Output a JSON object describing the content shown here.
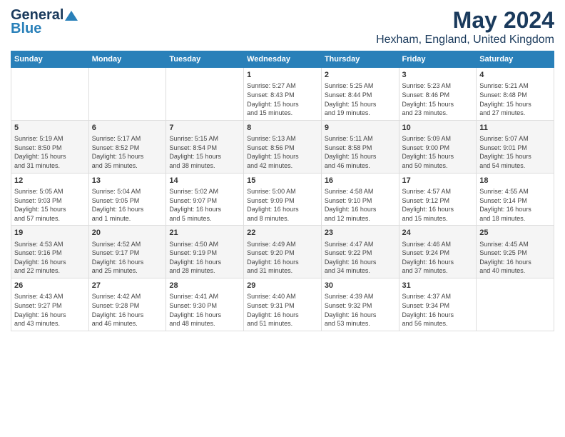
{
  "logo": {
    "line1": "General",
    "line2": "Blue"
  },
  "title": "May 2024",
  "subtitle": "Hexham, England, United Kingdom",
  "days_of_week": [
    "Sunday",
    "Monday",
    "Tuesday",
    "Wednesday",
    "Thursday",
    "Friday",
    "Saturday"
  ],
  "weeks": [
    [
      {
        "day": "",
        "content": ""
      },
      {
        "day": "",
        "content": ""
      },
      {
        "day": "",
        "content": ""
      },
      {
        "day": "1",
        "content": "Sunrise: 5:27 AM\nSunset: 8:43 PM\nDaylight: 15 hours\nand 15 minutes."
      },
      {
        "day": "2",
        "content": "Sunrise: 5:25 AM\nSunset: 8:44 PM\nDaylight: 15 hours\nand 19 minutes."
      },
      {
        "day": "3",
        "content": "Sunrise: 5:23 AM\nSunset: 8:46 PM\nDaylight: 15 hours\nand 23 minutes."
      },
      {
        "day": "4",
        "content": "Sunrise: 5:21 AM\nSunset: 8:48 PM\nDaylight: 15 hours\nand 27 minutes."
      }
    ],
    [
      {
        "day": "5",
        "content": "Sunrise: 5:19 AM\nSunset: 8:50 PM\nDaylight: 15 hours\nand 31 minutes."
      },
      {
        "day": "6",
        "content": "Sunrise: 5:17 AM\nSunset: 8:52 PM\nDaylight: 15 hours\nand 35 minutes."
      },
      {
        "day": "7",
        "content": "Sunrise: 5:15 AM\nSunset: 8:54 PM\nDaylight: 15 hours\nand 38 minutes."
      },
      {
        "day": "8",
        "content": "Sunrise: 5:13 AM\nSunset: 8:56 PM\nDaylight: 15 hours\nand 42 minutes."
      },
      {
        "day": "9",
        "content": "Sunrise: 5:11 AM\nSunset: 8:58 PM\nDaylight: 15 hours\nand 46 minutes."
      },
      {
        "day": "10",
        "content": "Sunrise: 5:09 AM\nSunset: 9:00 PM\nDaylight: 15 hours\nand 50 minutes."
      },
      {
        "day": "11",
        "content": "Sunrise: 5:07 AM\nSunset: 9:01 PM\nDaylight: 15 hours\nand 54 minutes."
      }
    ],
    [
      {
        "day": "12",
        "content": "Sunrise: 5:05 AM\nSunset: 9:03 PM\nDaylight: 15 hours\nand 57 minutes."
      },
      {
        "day": "13",
        "content": "Sunrise: 5:04 AM\nSunset: 9:05 PM\nDaylight: 16 hours\nand 1 minute."
      },
      {
        "day": "14",
        "content": "Sunrise: 5:02 AM\nSunset: 9:07 PM\nDaylight: 16 hours\nand 5 minutes."
      },
      {
        "day": "15",
        "content": "Sunrise: 5:00 AM\nSunset: 9:09 PM\nDaylight: 16 hours\nand 8 minutes."
      },
      {
        "day": "16",
        "content": "Sunrise: 4:58 AM\nSunset: 9:10 PM\nDaylight: 16 hours\nand 12 minutes."
      },
      {
        "day": "17",
        "content": "Sunrise: 4:57 AM\nSunset: 9:12 PM\nDaylight: 16 hours\nand 15 minutes."
      },
      {
        "day": "18",
        "content": "Sunrise: 4:55 AM\nSunset: 9:14 PM\nDaylight: 16 hours\nand 18 minutes."
      }
    ],
    [
      {
        "day": "19",
        "content": "Sunrise: 4:53 AM\nSunset: 9:16 PM\nDaylight: 16 hours\nand 22 minutes."
      },
      {
        "day": "20",
        "content": "Sunrise: 4:52 AM\nSunset: 9:17 PM\nDaylight: 16 hours\nand 25 minutes."
      },
      {
        "day": "21",
        "content": "Sunrise: 4:50 AM\nSunset: 9:19 PM\nDaylight: 16 hours\nand 28 minutes."
      },
      {
        "day": "22",
        "content": "Sunrise: 4:49 AM\nSunset: 9:20 PM\nDaylight: 16 hours\nand 31 minutes."
      },
      {
        "day": "23",
        "content": "Sunrise: 4:47 AM\nSunset: 9:22 PM\nDaylight: 16 hours\nand 34 minutes."
      },
      {
        "day": "24",
        "content": "Sunrise: 4:46 AM\nSunset: 9:24 PM\nDaylight: 16 hours\nand 37 minutes."
      },
      {
        "day": "25",
        "content": "Sunrise: 4:45 AM\nSunset: 9:25 PM\nDaylight: 16 hours\nand 40 minutes."
      }
    ],
    [
      {
        "day": "26",
        "content": "Sunrise: 4:43 AM\nSunset: 9:27 PM\nDaylight: 16 hours\nand 43 minutes."
      },
      {
        "day": "27",
        "content": "Sunrise: 4:42 AM\nSunset: 9:28 PM\nDaylight: 16 hours\nand 46 minutes."
      },
      {
        "day": "28",
        "content": "Sunrise: 4:41 AM\nSunset: 9:30 PM\nDaylight: 16 hours\nand 48 minutes."
      },
      {
        "day": "29",
        "content": "Sunrise: 4:40 AM\nSunset: 9:31 PM\nDaylight: 16 hours\nand 51 minutes."
      },
      {
        "day": "30",
        "content": "Sunrise: 4:39 AM\nSunset: 9:32 PM\nDaylight: 16 hours\nand 53 minutes."
      },
      {
        "day": "31",
        "content": "Sunrise: 4:37 AM\nSunset: 9:34 PM\nDaylight: 16 hours\nand 56 minutes."
      },
      {
        "day": "",
        "content": ""
      }
    ]
  ]
}
